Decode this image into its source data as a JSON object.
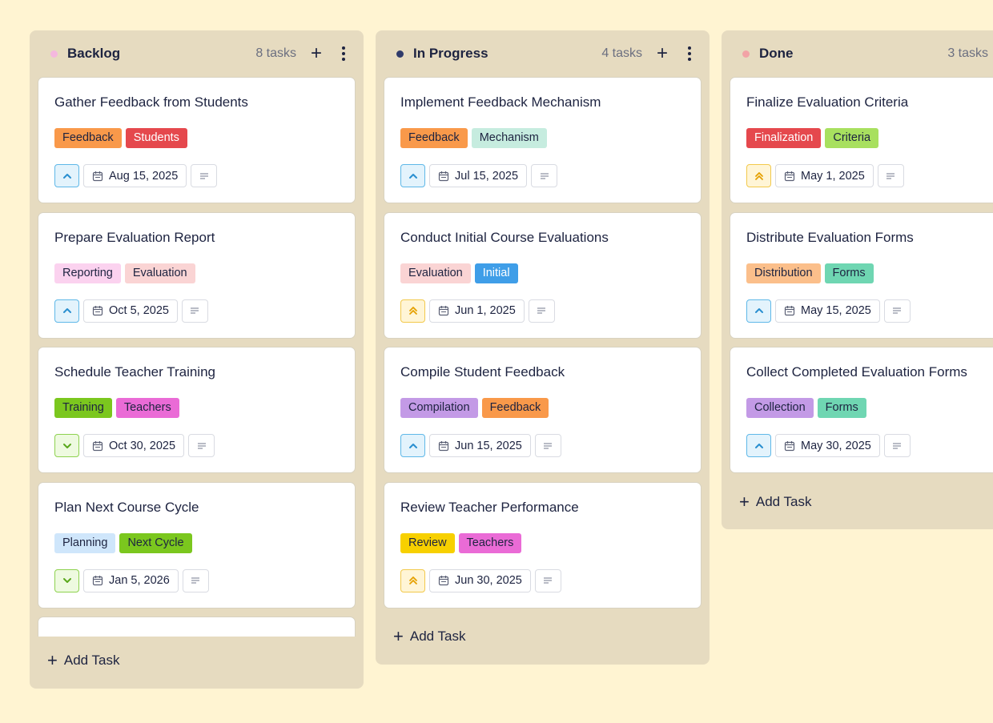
{
  "columns": [
    {
      "title": "Backlog",
      "count": "8 tasks",
      "dot_color": "#f4b8de",
      "add_label": "Add Task",
      "cards": [
        {
          "title": "Gather Feedback from Students",
          "priority": "high",
          "date": "Aug 15, 2025",
          "tags": [
            {
              "label": "Feedback",
              "bg": "#f9994a",
              "fg": "#1d2340"
            },
            {
              "label": "Students",
              "bg": "#e5484d",
              "fg": "#ffffff"
            }
          ]
        },
        {
          "title": "Prepare Evaluation Report",
          "priority": "high",
          "date": "Oct 5, 2025",
          "tags": [
            {
              "label": "Reporting",
              "bg": "#fbd2ef",
              "fg": "#1d2340"
            },
            {
              "label": "Evaluation",
              "bg": "#fad4d4",
              "fg": "#1d2340"
            }
          ]
        },
        {
          "title": "Schedule Teacher Training",
          "priority": "low",
          "date": "Oct 30, 2025",
          "tags": [
            {
              "label": "Training",
              "bg": "#7bc71e",
              "fg": "#1d2340"
            },
            {
              "label": "Teachers",
              "bg": "#ea6bd6",
              "fg": "#1d2340"
            }
          ]
        },
        {
          "title": "Plan Next Course Cycle",
          "priority": "low",
          "date": "Jan 5, 2026",
          "tags": [
            {
              "label": "Planning",
              "bg": "#cfe6fb",
              "fg": "#1d2340"
            },
            {
              "label": "Next Cycle",
              "bg": "#7bc71e",
              "fg": "#1d2340"
            }
          ]
        }
      ]
    },
    {
      "title": "In Progress",
      "count": "4 tasks",
      "dot_color": "#2f3b6b",
      "add_label": "Add Task",
      "cards": [
        {
          "title": "Implement Feedback Mechanism",
          "priority": "high",
          "date": "Jul 15, 2025",
          "tags": [
            {
              "label": "Feedback",
              "bg": "#f9994a",
              "fg": "#1d2340"
            },
            {
              "label": "Mechanism",
              "bg": "#c6ecdf",
              "fg": "#1d2340"
            }
          ]
        },
        {
          "title": "Conduct Initial Course Evaluations",
          "priority": "urgent",
          "date": "Jun 1, 2025",
          "tags": [
            {
              "label": "Evaluation",
              "bg": "#fad4d4",
              "fg": "#1d2340"
            },
            {
              "label": "Initial",
              "bg": "#3f9ee8",
              "fg": "#ffffff"
            }
          ]
        },
        {
          "title": "Compile Student Feedback",
          "priority": "high",
          "date": "Jun 15, 2025",
          "tags": [
            {
              "label": "Compilation",
              "bg": "#c39ae6",
              "fg": "#1d2340"
            },
            {
              "label": "Feedback",
              "bg": "#f9994a",
              "fg": "#1d2340"
            }
          ]
        },
        {
          "title": "Review Teacher Performance",
          "priority": "urgent",
          "date": "Jun 30, 2025",
          "tags": [
            {
              "label": "Review",
              "bg": "#f7d000",
              "fg": "#1d2340"
            },
            {
              "label": "Teachers",
              "bg": "#ea6bd6",
              "fg": "#1d2340"
            }
          ]
        }
      ]
    },
    {
      "title": "Done",
      "count": "3 tasks",
      "dot_color": "#f2a3a6",
      "add_label": "Add Task",
      "cards": [
        {
          "title": "Finalize Evaluation Criteria",
          "priority": "urgent",
          "date": "May 1, 2025",
          "tags": [
            {
              "label": "Finalization",
              "bg": "#e5484d",
              "fg": "#ffffff"
            },
            {
              "label": "Criteria",
              "bg": "#a8e05f",
              "fg": "#1d2340"
            }
          ]
        },
        {
          "title": "Distribute Evaluation Forms",
          "priority": "high",
          "date": "May 15, 2025",
          "tags": [
            {
              "label": "Distribution",
              "bg": "#fbbf8b",
              "fg": "#1d2340"
            },
            {
              "label": "Forms",
              "bg": "#6fd6b2",
              "fg": "#1d2340"
            }
          ]
        },
        {
          "title": "Collect Completed Evaluation Forms",
          "priority": "high",
          "date": "May 30, 2025",
          "tags": [
            {
              "label": "Collection",
              "bg": "#c39ae6",
              "fg": "#1d2340"
            },
            {
              "label": "Forms",
              "bg": "#6fd6b2",
              "fg": "#1d2340"
            }
          ]
        }
      ]
    }
  ]
}
